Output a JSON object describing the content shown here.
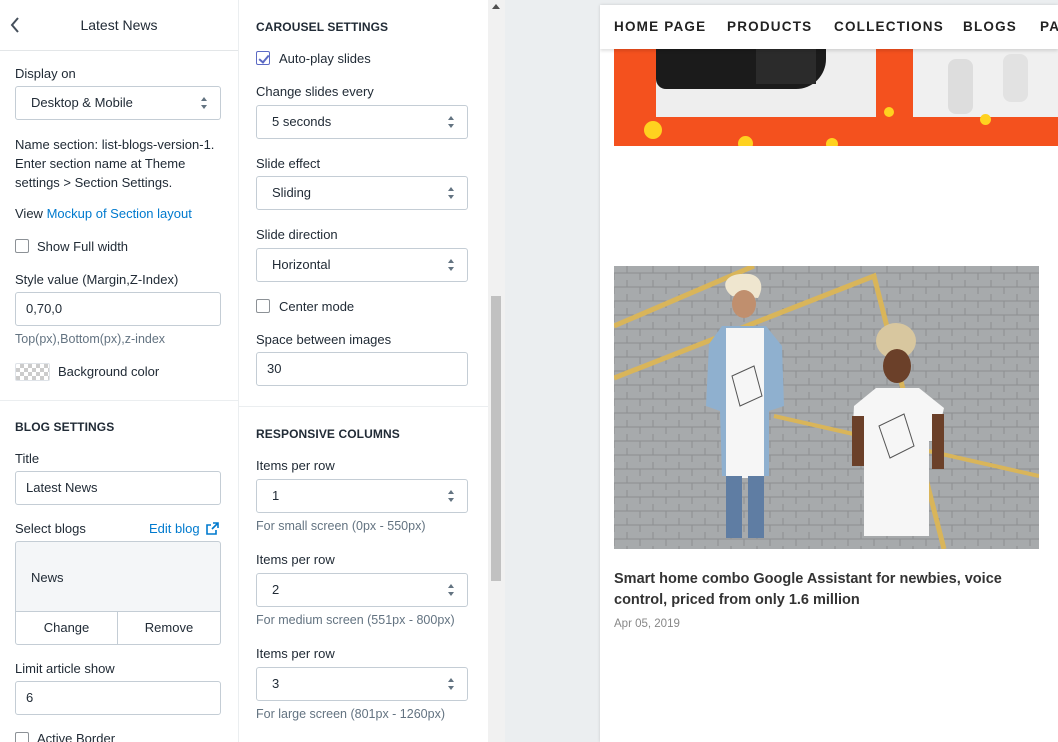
{
  "left_panel": {
    "back_label": "<",
    "header_title": "Latest News",
    "display_on": {
      "label": "Display on",
      "value": "Desktop & Mobile"
    },
    "name_section_text": "Name section: list-blogs-version-1. Enter section name at Theme settings > Section Settings.",
    "view_prefix": "View",
    "view_link": "Mockup of Section layout",
    "show_full_width": {
      "label": "Show Full width",
      "checked": false
    },
    "style_value": {
      "label": "Style value (Margin,Z-Index)",
      "value": "0,70,0",
      "help": "Top(px),Bottom(px),z-index"
    },
    "background_color_label": "Background color",
    "blog_settings": {
      "heading": "BLOG SETTINGS",
      "title_label": "Title",
      "title_value": "Latest News",
      "select_blogs_label": "Select blogs",
      "edit_blog_label": "Edit blog",
      "selected_blog": "News",
      "change_label": "Change",
      "remove_label": "Remove",
      "limit_label": "Limit article show",
      "limit_value": "6",
      "active_border_label": "Active Border"
    }
  },
  "mid_panel": {
    "carousel": {
      "heading": "CAROUSEL SETTINGS",
      "autoplay_label": "Auto-play slides",
      "autoplay_checked": true,
      "change_every_label": "Change slides every",
      "change_every_value": "5 seconds",
      "effect_label": "Slide effect",
      "effect_value": "Sliding",
      "direction_label": "Slide direction",
      "direction_value": "Horizontal",
      "center_mode_label": "Center mode",
      "center_mode_checked": false,
      "space_label": "Space between images",
      "space_value": "30"
    },
    "responsive": {
      "heading": "RESPONSIVE COLUMNS",
      "rows": [
        {
          "label": "Items per row",
          "value": "1",
          "help": "For small screen (0px - 550px)"
        },
        {
          "label": "Items per row",
          "value": "2",
          "help": "For medium screen (551px - 800px)"
        },
        {
          "label": "Items per row",
          "value": "3",
          "help": "For large screen (801px - 1260px)"
        }
      ]
    }
  },
  "preview": {
    "nav": [
      "HOME PAGE",
      "PRODUCTS",
      "COLLECTIONS",
      "BLOGS",
      "PA"
    ],
    "post_title": "Smart home combo Google Assistant for newbies, voice control, priced from only 1.6 million",
    "post_date": "Apr 05, 2019"
  },
  "colors": {
    "accent": "#5c6ac4",
    "link": "#007ace",
    "banner": "#f4511e"
  }
}
